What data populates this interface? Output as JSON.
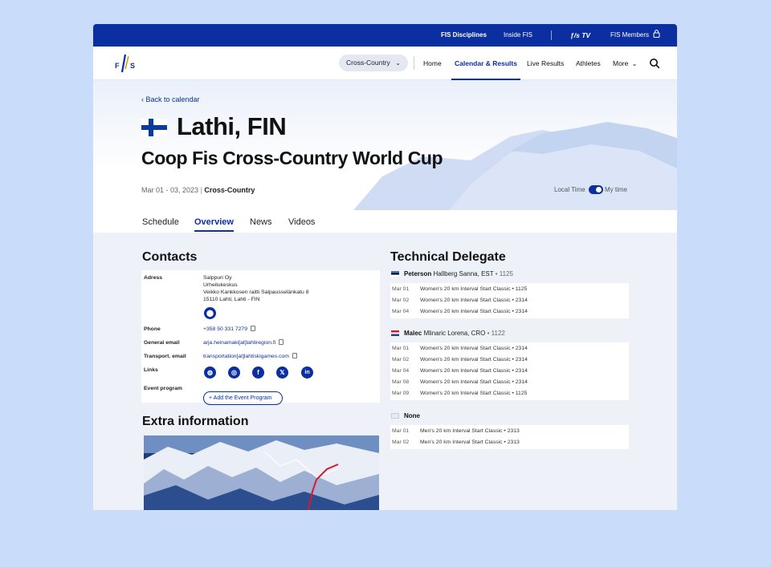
{
  "topbar": {
    "disciplines": "FIS Disciplines",
    "inside": "Inside FIS",
    "tv": "TV",
    "members": "FIS Members"
  },
  "nav": {
    "discipline_select": "Cross-Country",
    "links": [
      "Home",
      "Calendar & Results",
      "Live Results",
      "Athletes",
      "More"
    ],
    "active": "Calendar & Results"
  },
  "hero": {
    "back": "Back to calendar",
    "city": "Lathi, FIN",
    "title": "Coop Fis Cross-Country World Cup",
    "dates": "Mar 01 - 03, 2023",
    "discipline": "Cross-Country",
    "local_time": "Local Time",
    "my_time": "My time"
  },
  "tabs": [
    "Schedule",
    "Overview",
    "News",
    "Videos"
  ],
  "contacts": {
    "heading": "Contacts",
    "address_label": "Adress",
    "address_lines": [
      "Salppuri Oy",
      "Urheilukeskus",
      "Veikko Kankkosen raitti Salpausselänkatu 8",
      "15110 Lahti, Lahti  - FIN"
    ],
    "phone_label": "Phone",
    "phone": "+358 50 331 7279",
    "email_label": "General email",
    "email": "arja.heinamaki[at]lahtiregion.fi",
    "transport_label": "Transport. email",
    "transport": "transportation[at]lahtiskigames.com",
    "links_label": "Links",
    "program_label": "Event program",
    "program_button": "Add the Event Program"
  },
  "extra": {
    "heading": "Extra information"
  },
  "delegate": {
    "heading": "Technical Delegate",
    "groups": [
      {
        "surname": "Peterson",
        "rest": "Hallberg Sanna, EST",
        "num": "1125",
        "rows": [
          {
            "date": "Mar 01",
            "event": "Women's 20 km Interval Start Classic",
            "code": "1125"
          },
          {
            "date": "Mar 02",
            "event": "Women's 20 km Interval Start Classic",
            "code": "2314"
          },
          {
            "date": "Mar 04",
            "event": "Women's 20 km Interval Start Classic",
            "code": "2314"
          }
        ]
      },
      {
        "surname": "Malec",
        "rest": "Mlinaric Lorena, CRO",
        "num": "1122",
        "rows": [
          {
            "date": "Mar 01",
            "event": "Women's 20 km Interval Start Classic",
            "code": "2314"
          },
          {
            "date": "Mar 02",
            "event": "Women's 20 km Interval Start Classic",
            "code": "2314"
          },
          {
            "date": "Mar 04",
            "event": "Women's 20 km Interval Start Classic",
            "code": "2314"
          },
          {
            "date": "Mar 08",
            "event": "Women's 20 km Interval Start Classic",
            "code": "2314"
          },
          {
            "date": "Mar 09",
            "event": "Women's 20 km Interval Start Classic",
            "code": "1125"
          }
        ]
      },
      {
        "surname": "None",
        "rest": "",
        "num": "",
        "rows": [
          {
            "date": "Mar 01",
            "event": "Men's 20 km Interval Start Classic",
            "code": "2313"
          },
          {
            "date": "Mar 02",
            "event": "Men's 20 km Interval Start Classic",
            "code": "2313"
          }
        ]
      }
    ]
  },
  "colors": {
    "brand": "#0b2ea0",
    "background": "#c9dcfa",
    "route": "#d51a2a"
  },
  "icons": [
    "lock-icon",
    "search-icon",
    "chevron-down-icon",
    "chevron-left-icon",
    "map-pin-icon",
    "copy-icon",
    "globe-icon",
    "instagram-icon",
    "facebook-icon",
    "x-icon",
    "linkedin-icon",
    "plus-icon"
  ]
}
